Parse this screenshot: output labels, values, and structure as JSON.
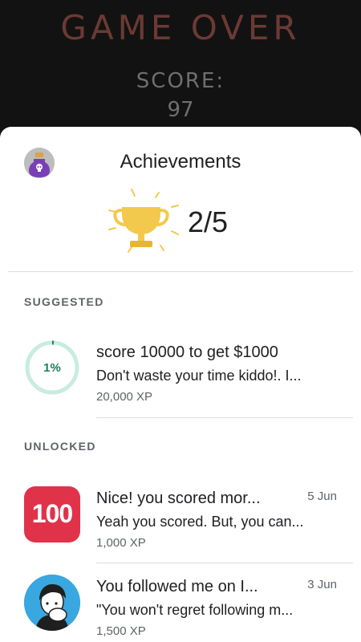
{
  "game": {
    "title": "GAME OVER",
    "score_label": "SCORE:",
    "score_value": "97"
  },
  "sheet": {
    "title": "Achievements",
    "count": "2/5"
  },
  "sections": {
    "suggested": "SUGGESTED",
    "unlocked": "UNLOCKED"
  },
  "suggested": [
    {
      "progress": "1%",
      "progress_fraction": 0.01,
      "title": "score 10000 to get $1000",
      "description": "Don't waste your time kiddo!. I...",
      "xp": "20,000 XP"
    }
  ],
  "unlocked": [
    {
      "icon": "100-badge-icon",
      "icon_text": "100",
      "title": "Nice! you scored mor...",
      "description": "Yeah you scored. But, you can...",
      "xp": "1,000 XP",
      "date": "5 Jun"
    },
    {
      "icon": "avatar-illustration-icon",
      "title": "You followed me on I...",
      "description": "\"You won't regret following m...",
      "xp": "1,500 XP",
      "date": "3 Jun"
    }
  ],
  "colors": {
    "progress_ring": "#c8ece0",
    "progress_fill": "#1a7f5a",
    "badge_red": "#e0334a",
    "trophy_gold": "#f2c94c"
  }
}
